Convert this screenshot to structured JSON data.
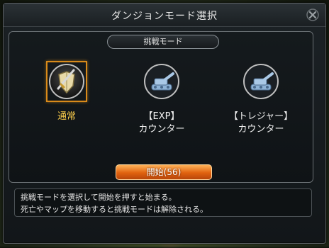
{
  "window": {
    "title": "ダンジョンモード選択",
    "close_icon": "close-x-icon"
  },
  "section": {
    "tab_label": "挑戦モード"
  },
  "modes": [
    {
      "label": "通常",
      "icon": "shield-sword-icon",
      "selected": true
    },
    {
      "label": "【EXP】\nカウンター",
      "icon": "tank-icon",
      "selected": false
    },
    {
      "label": "【トレジャー】\nカウンター",
      "icon": "tank-icon",
      "selected": false
    }
  ],
  "start_button": {
    "label": "開始(56)"
  },
  "description": {
    "line1": "挑戦モードを選択して開始を押すと始まる。",
    "line2": "死亡やマップを移動すると挑戦モードは解除される。"
  },
  "colors": {
    "selected_frame": "#d98a1a",
    "selected_label": "#f7c94a",
    "button_orange": "#e0620f"
  }
}
